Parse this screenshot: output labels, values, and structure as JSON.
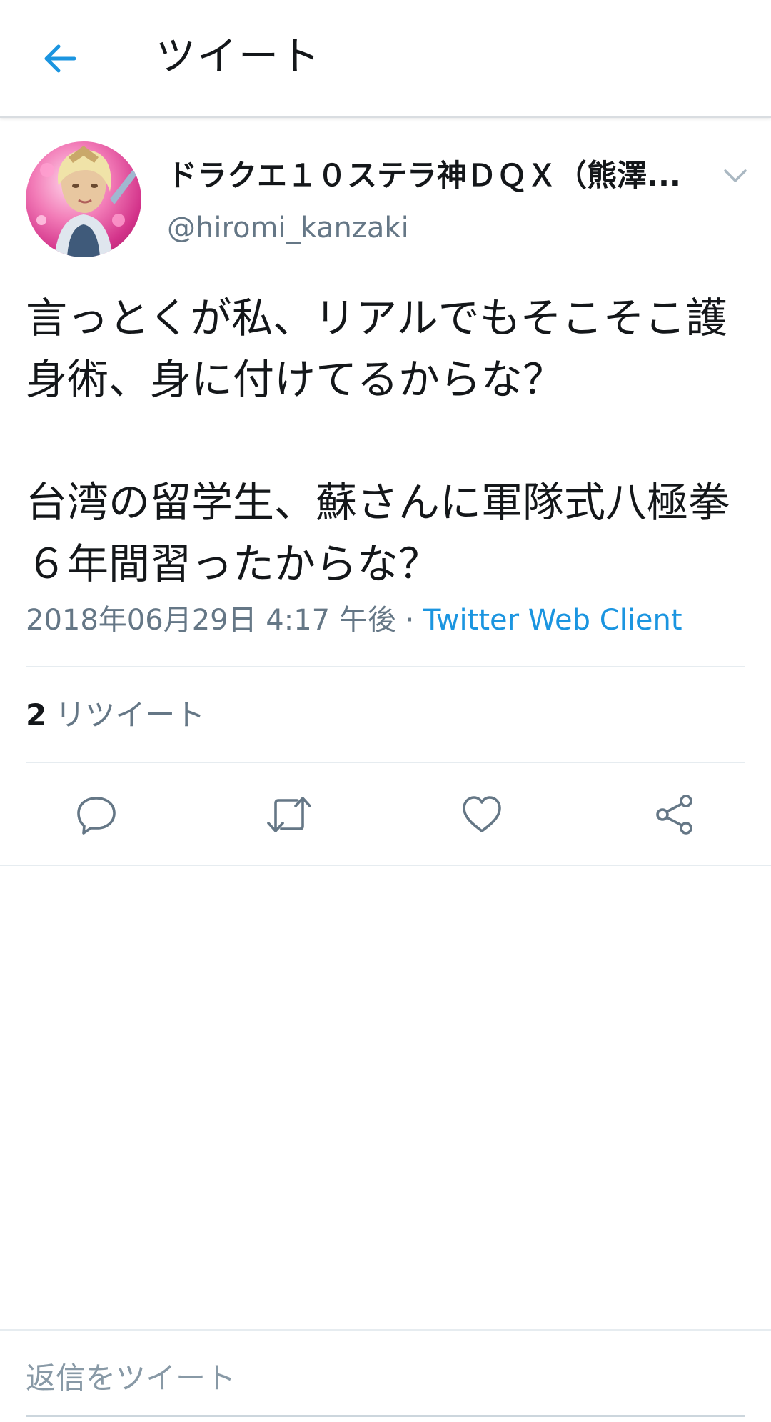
{
  "header": {
    "back_icon": "arrow-left-icon",
    "title": "ツイート"
  },
  "tweet": {
    "display_name": "ドラクエ１０ステラ神ＤＱＸ（熊澤...",
    "handle": "@hiromi_kanzaki",
    "text": "言っとくが私、リアルでもそこそこ護身術、身に付けてるからな？\n\n台湾の留学生、蘇さんに軍隊式八極拳６年間習ったからな？",
    "timestamp": "2018年06月29日 4:17 午後",
    "separator": "·",
    "client": "Twitter Web Client",
    "retweet_count": "2",
    "retweet_label": "リツイート"
  },
  "actions": {
    "reply_icon": "reply-icon",
    "retweet_icon": "retweet-icon",
    "like_icon": "heart-icon",
    "share_icon": "share-icon"
  },
  "reply_composer": {
    "placeholder": "返信をツイート"
  },
  "colors": {
    "accent": "#1b95e0",
    "secondary_text": "#657786",
    "primary_text": "#14171a",
    "divider": "#e6ecf0"
  }
}
